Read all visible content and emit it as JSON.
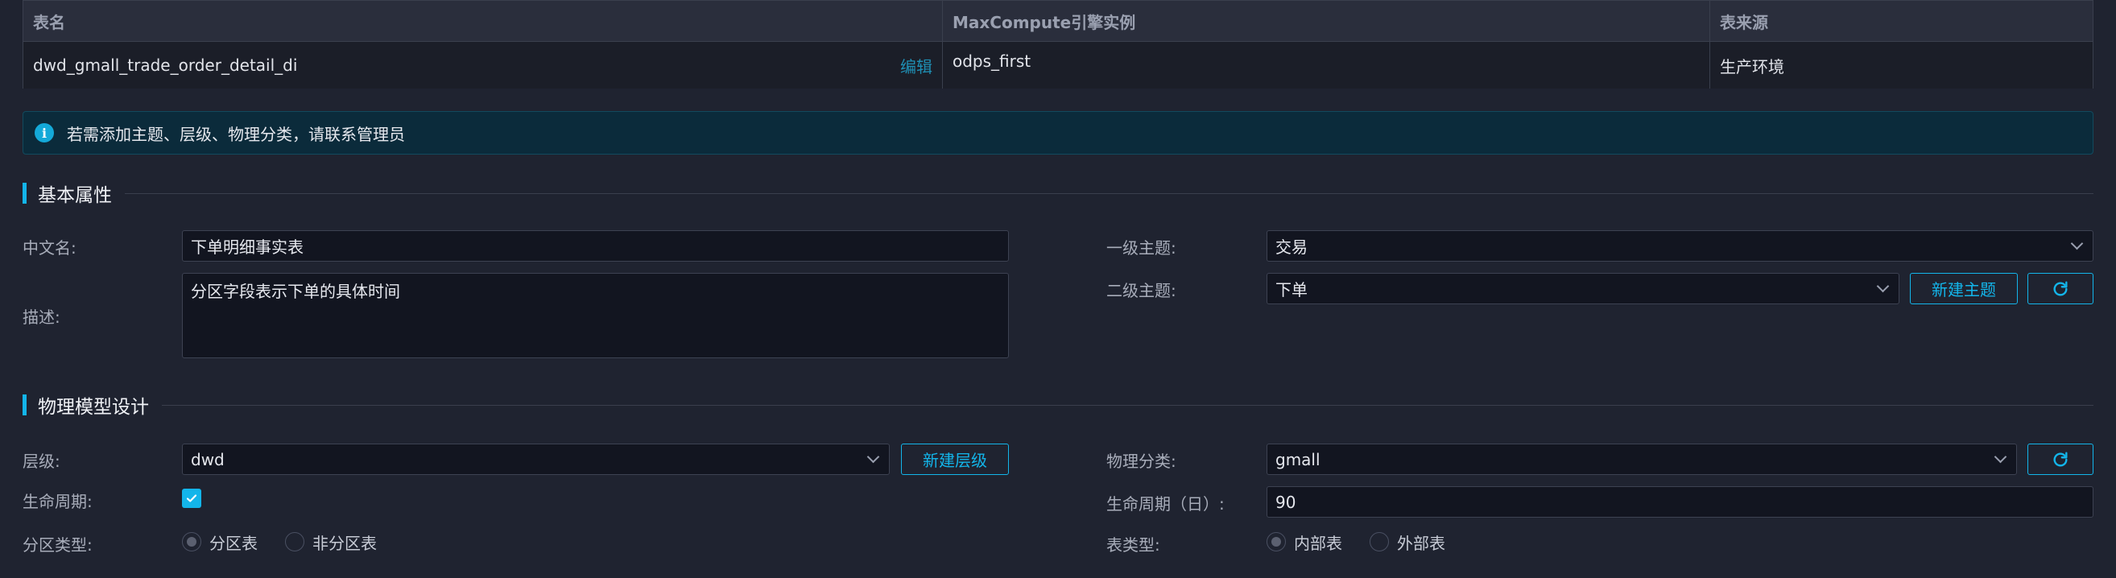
{
  "table": {
    "headers": [
      "表名",
      "MaxCompute引擎实例",
      "表来源"
    ],
    "row": {
      "name": "dwd_gmall_trade_order_detail_di",
      "edit": "编辑",
      "instance": "odps_first",
      "source": "生产环境"
    }
  },
  "banner": {
    "icon": "info-icon",
    "text": "若需添加主题、层级、物理分类，请联系管理员"
  },
  "basic": {
    "title": "基本属性",
    "cn_name_label": "中文名:",
    "cn_name_value": "下单明细事实表",
    "desc_label": "描述:",
    "desc_value": "分区字段表示下单的具体时间",
    "topic1_label": "一级主题:",
    "topic1_value": "交易",
    "topic2_label": "二级主题:",
    "topic2_value": "下单",
    "new_topic_button": "新建主题"
  },
  "physical": {
    "title": "物理模型设计",
    "layer_label": "层级:",
    "layer_value": "dwd",
    "new_layer_button": "新建层级",
    "category_label": "物理分类:",
    "category_value": "gmall",
    "lifecycle_label": "生命周期:",
    "lifecycle_checked": true,
    "lifecycle_days_label": "生命周期（日）:",
    "lifecycle_days_value": "90",
    "partition_label": "分区类型:",
    "partition_options": [
      "分区表",
      "非分区表"
    ],
    "partition_selected": "分区表",
    "table_type_label": "表类型:",
    "table_type_options": [
      "内部表",
      "外部表"
    ],
    "table_type_selected": "内部表"
  },
  "colors": {
    "accent": "#13b5ea",
    "background": "#1f2330",
    "banner": "#0b2b3b"
  }
}
